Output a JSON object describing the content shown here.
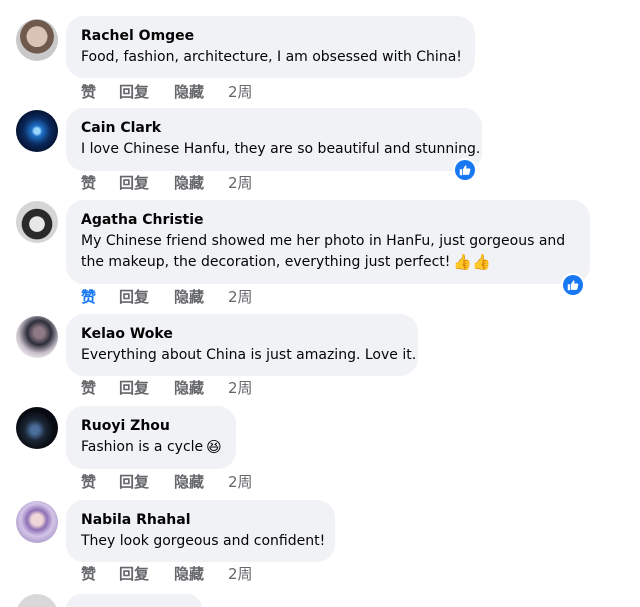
{
  "actions": {
    "like": "赞",
    "reply": "回复",
    "hide": "隐藏"
  },
  "colors": {
    "bubble": "#f0f2f5",
    "action_text": "#65676b",
    "accent": "#1877f2"
  },
  "comments": [
    {
      "author": "Rachel Omgee",
      "text": "Food, fashion, architecture, I am obsessed with China!",
      "time": "2周",
      "liked": false
    },
    {
      "author": "Cain Clark",
      "text": "I love Chinese Hanfu, they are so beautiful and stunning.",
      "time": "2周",
      "liked": false,
      "reaction_icon": "thumbs-up-icon"
    },
    {
      "author": "Agatha Christie",
      "text": "My Chinese friend showed me her photo in HanFu, just gorgeous and the makeup, the decoration, everything just perfect!",
      "emoji": "👍👍",
      "time": "2周",
      "liked": true,
      "reaction_icon": "thumbs-up-icon"
    },
    {
      "author": "Kelao Woke",
      "text": "Everything about China is just amazing. Love it.",
      "time": "2周",
      "liked": false
    },
    {
      "author": "Ruoyi Zhou",
      "text": "Fashion is a cycle",
      "emoji": "😆",
      "time": "2周",
      "liked": false
    },
    {
      "author": "Nabila Rhahal",
      "text": "They look gorgeous and confident!",
      "time": "2周",
      "liked": false
    }
  ]
}
